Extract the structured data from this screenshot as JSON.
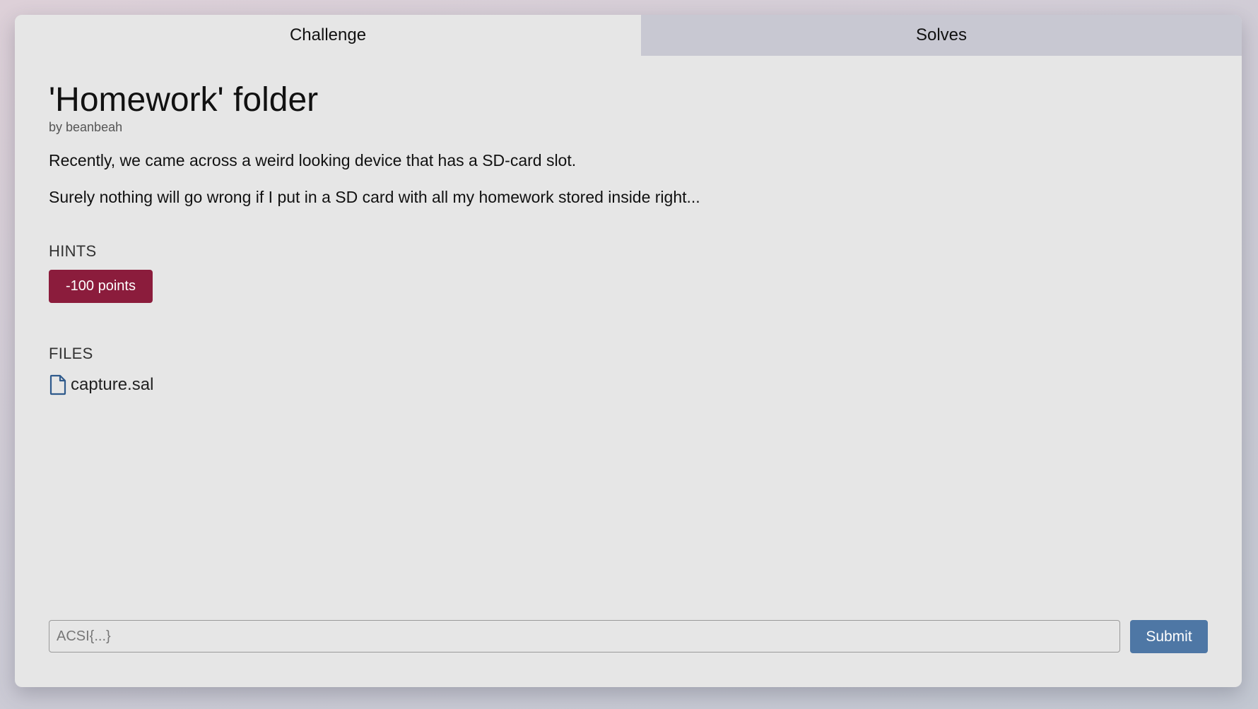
{
  "tabs": {
    "challenge": "Challenge",
    "solves": "Solves"
  },
  "challenge": {
    "title": "'Homework' folder",
    "author": "by beanbeah",
    "description": [
      "Recently, we came across a weird looking device that has a SD-card slot.",
      "Surely nothing will go wrong if I put in a SD card with all my homework stored inside right..."
    ]
  },
  "hints": {
    "heading": "HINTS",
    "items": [
      {
        "label": "-100 points",
        "color": "#8b1c3c"
      }
    ]
  },
  "files": {
    "heading": "FILES",
    "items": [
      {
        "name": "capture.sal",
        "icon": "file-icon"
      }
    ]
  },
  "flag_form": {
    "placeholder": "ACSI{...}",
    "value": "",
    "submit_label": "Submit",
    "submit_color": "#4e77a5"
  }
}
